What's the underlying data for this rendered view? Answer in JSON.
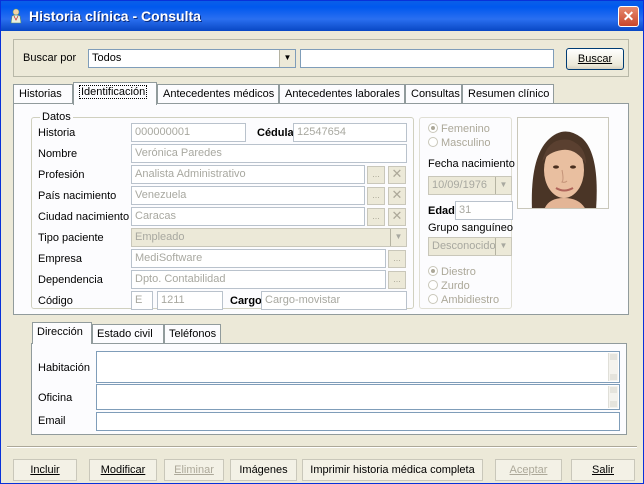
{
  "window": {
    "title": "Historia clínica - Consulta",
    "close_glyph": "✕"
  },
  "search": {
    "label": "Buscar por",
    "field_value": "Todos",
    "query_value": "",
    "button_label": "Buscar"
  },
  "tabs": [
    "Historias",
    "Identificación",
    "Antecedentes médicos",
    "Antecedentes laborales",
    "Consultas",
    "Resumen clínico"
  ],
  "datos": {
    "legend": "Datos",
    "historia_label": "Historia",
    "historia_value": "000000001",
    "cedula_label": "Cédula",
    "cedula_value": "12547654",
    "nombre_label": "Nombre",
    "nombre_value": "Verónica Paredes",
    "profesion_label": "Profesión",
    "profesion_value": "Analista Administrativo",
    "pais_label": "País nacimiento",
    "pais_value": "Venezuela",
    "ciudad_label": "Ciudad nacimiento",
    "ciudad_value": "Caracas",
    "tipo_label": "Tipo paciente",
    "tipo_value": "Empleado",
    "empresa_label": "Empresa",
    "empresa_value": "MediSoftware",
    "dependencia_label": "Dependencia",
    "dependencia_value": "Dpto. Contabilidad",
    "codigo_label": "Código",
    "codigo_prefix": "E",
    "codigo_value": "1211",
    "cargo_label": "Cargo",
    "cargo_value": "Cargo-movistar"
  },
  "right_panel": {
    "sexo": [
      "Femenino",
      "Masculino"
    ],
    "sexo_selected": "Femenino",
    "fecha_label": "Fecha nacimiento",
    "fecha_value": "10/09/1976",
    "edad_label": "Edad",
    "edad_value": "31",
    "grupo_label": "Grupo sanguíneo",
    "grupo_value": "Desconocido",
    "lateralidad": [
      "Diestro",
      "Zurdo",
      "Ambidiestro"
    ],
    "lateralidad_selected": "Diestro"
  },
  "sub_tabs": [
    "Dirección",
    "Estado civil",
    "Teléfonos"
  ],
  "direccion": {
    "habitacion_label": "Habitación",
    "oficina_label": "Oficina",
    "email_label": "Email"
  },
  "bottom_buttons": [
    "Incluir",
    "Modificar",
    "Eliminar",
    "Imágenes",
    "Imprimir historia médica completa",
    "Aceptar",
    "Salir"
  ],
  "icons": {
    "ellipsis": "...",
    "clear": "✕",
    "arrow_down": "▼"
  },
  "colors": {
    "titlebar": "#0058ee",
    "window_bg": "#ece9d8",
    "disabled_text": "#aca899"
  }
}
